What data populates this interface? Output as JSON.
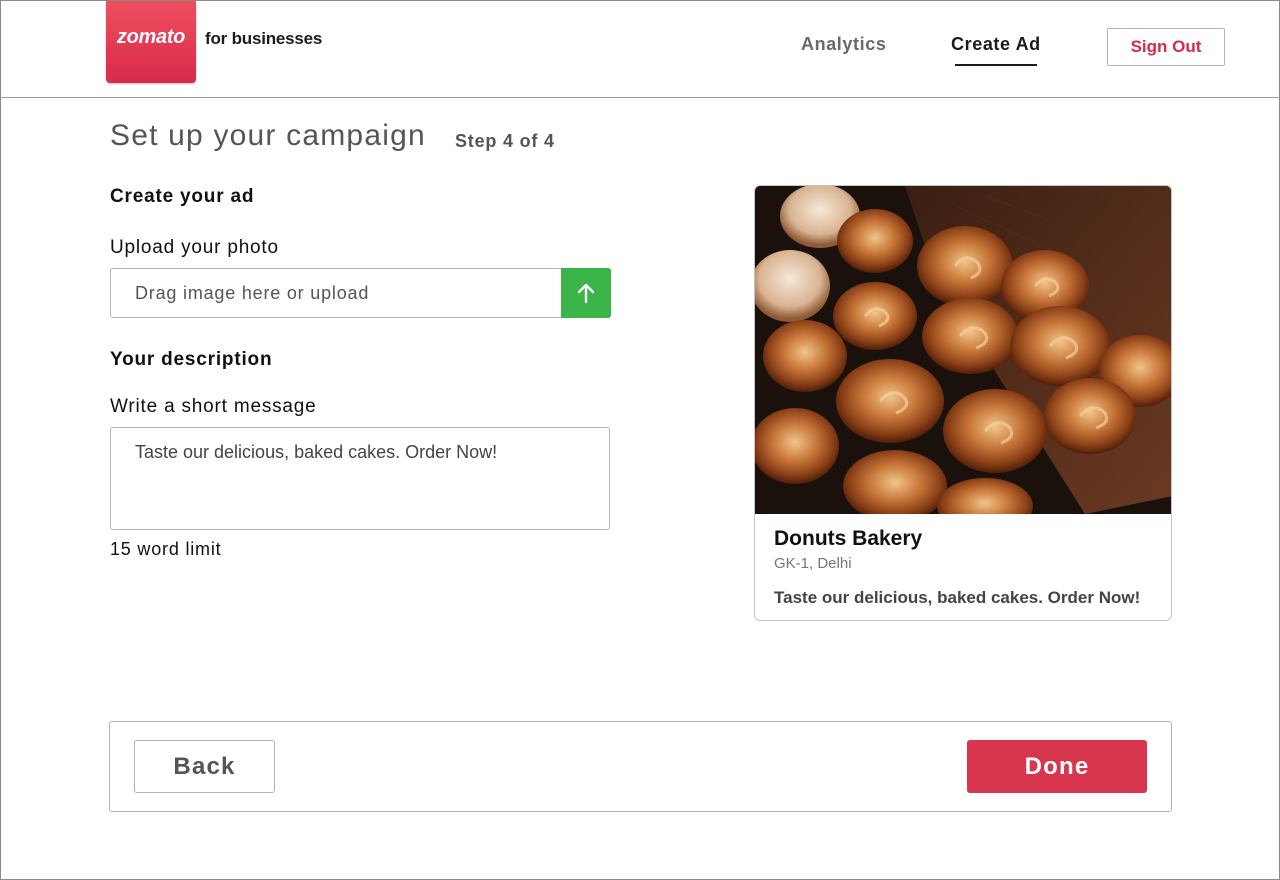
{
  "header": {
    "logo_text": "zomato",
    "brand_suffix": "for businesses",
    "nav": [
      {
        "label": "Analytics",
        "active": false
      },
      {
        "label": "Create Ad",
        "active": true
      }
    ],
    "sign_out_label": "Sign Out"
  },
  "page": {
    "title": "Set up your campaign",
    "step": "Step 4 of 4"
  },
  "form": {
    "section_ad": "Create your ad",
    "upload_label": "Upload your photo",
    "upload_placeholder": "Drag image here or upload",
    "upload_icon": "arrow-up-icon",
    "section_description": "Your description",
    "message_label": "Write a short message",
    "message_value": "Taste our delicious, baked cakes. Order Now!",
    "word_limit": "15 word limit"
  },
  "preview": {
    "image": "pastries-photo",
    "name": "Donuts Bakery",
    "location": "GK-1, Delhi",
    "message": "Taste our delicious, baked cakes. Order Now!"
  },
  "footer": {
    "back_label": "Back",
    "done_label": "Done"
  },
  "colors": {
    "brand": "#d8294a",
    "upload_button": "#3bb54a",
    "done_button": "#d8364e"
  }
}
